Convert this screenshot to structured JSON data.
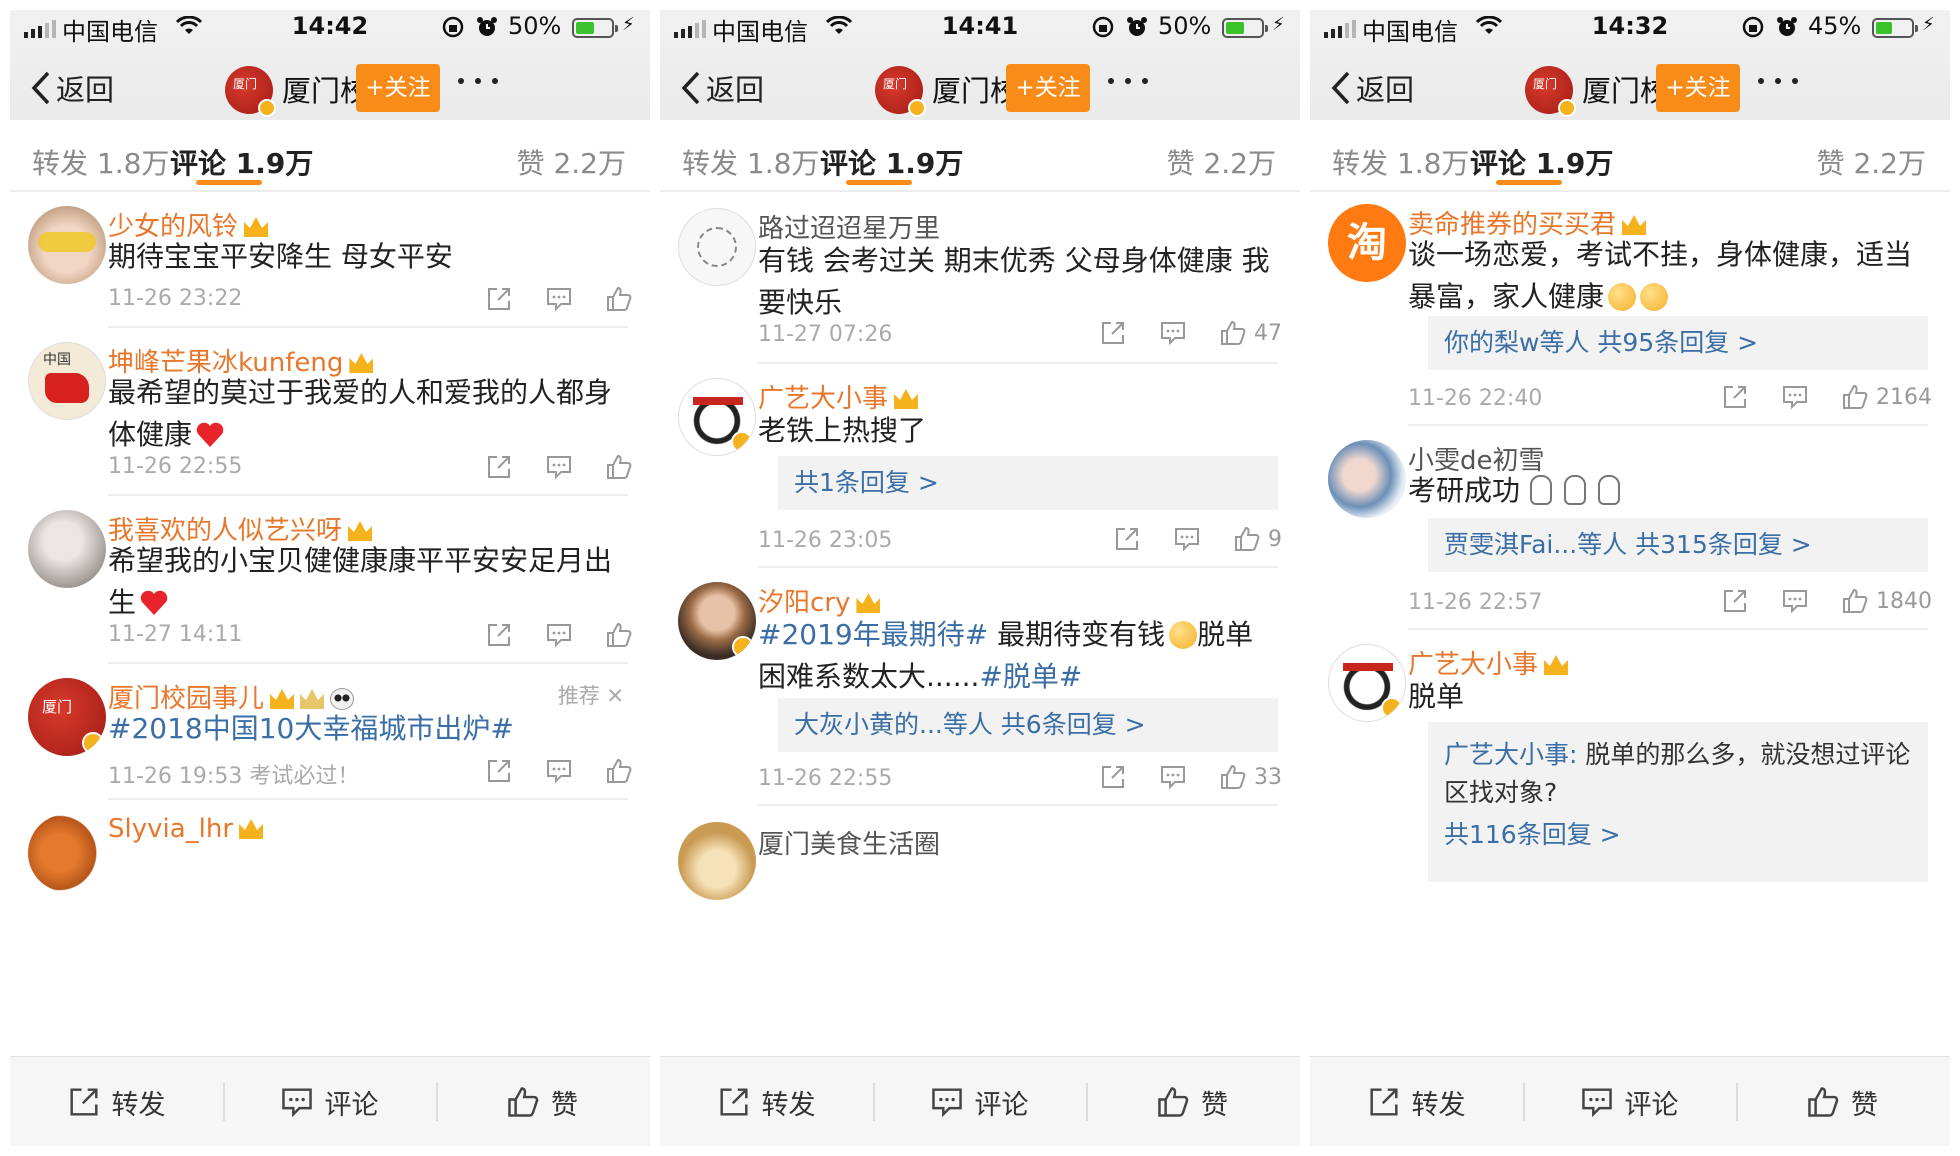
{
  "panels": [
    {
      "status": {
        "carrier": "中国电信",
        "time": "14:42",
        "battery": "50%"
      },
      "nav": {
        "back": "返回",
        "title": "厦门校园...",
        "follow": "+关注",
        "logo_text": "厦门"
      },
      "tabs": {
        "repost": "转发 1.8万",
        "comments": "评论 1.9万",
        "likes": "赞 2.2万"
      },
      "comments": [
        {
          "name": "少女的风铃",
          "text": "期待宝宝平安降生 母女平安",
          "time": "11-26 23:22",
          "likes": ""
        },
        {
          "name": "坤峰芒果冰kunfeng",
          "text": "最希望的莫过于我爱的人和爱我的人都身体健康",
          "time": "11-26 22:55",
          "likes": ""
        },
        {
          "name": "我喜欢的人似艺兴呀",
          "text": "希望我的小宝贝健健康康平平安安足月出生",
          "time": "11-27 14:11",
          "likes": ""
        },
        {
          "name": "厦门校园事儿",
          "text": "#2018中国10大幸福城市出炉#",
          "time": "11-26 19:53 考试必过！ ...",
          "likes": "",
          "tag": "推荐 ✕"
        },
        {
          "name": "Slyvia_lhr",
          "text": "",
          "time": "",
          "likes": ""
        }
      ],
      "bottom": {
        "repost": "转发",
        "comment": "评论",
        "like": "赞"
      }
    },
    {
      "status": {
        "carrier": "中国电信",
        "time": "14:41",
        "battery": "50%"
      },
      "nav": {
        "back": "返回",
        "title": "厦门校园...",
        "follow": "+关注",
        "logo_text": "厦门"
      },
      "tabs": {
        "repost": "转发 1.8万",
        "comments": "评论 1.9万",
        "likes": "赞 2.2万"
      },
      "comments": [
        {
          "name": "路过迢迢星万里",
          "text": "有钱 会考过关 期末优秀 父母身体健康 我要快乐",
          "time": "11-27 07:26",
          "likes": "47"
        },
        {
          "name": "广艺大小事",
          "text": "老铁上热搜了",
          "replies": "共1条回复 >",
          "time": "11-26 23:05",
          "likes": "9"
        },
        {
          "name": "汐阳cry",
          "text_topic1": "#2019年最期待#",
          "text_mid": " 最期待变有钱",
          "text_end": "脱单困难系数太大......",
          "text_topic2": "#脱单#",
          "replies": "大灰小黄的...等人  共6条回复 >",
          "time": "11-26 22:55",
          "likes": "33"
        },
        {
          "name": "厦门美食生活圈",
          "text": "",
          "time": "",
          "likes": ""
        }
      ],
      "bottom": {
        "repost": "转发",
        "comment": "评论",
        "like": "赞"
      }
    },
    {
      "status": {
        "carrier": "中国电信",
        "time": "14:32",
        "battery": "45%"
      },
      "nav": {
        "back": "返回",
        "title": "厦门校园...",
        "follow": "+关注",
        "logo_text": "厦门"
      },
      "tabs": {
        "repost": "转发 1.8万",
        "comments": "评论 1.9万",
        "likes": "赞 2.2万"
      },
      "comments": [
        {
          "name": "卖命推券的买买君",
          "text": "谈一场恋爱，考试不挂，身体健康，适当暴富，家人健康",
          "replies": "你的梨w等人  共95条回复 >",
          "time": "11-26 22:40",
          "likes": "2164",
          "avatar_char": "淘"
        },
        {
          "name": "小雯de初雪",
          "text": "考研成功",
          "replies": "贾雯淇Fai...等人  共315条回复 >",
          "time": "11-26 22:57",
          "likes": "1840"
        },
        {
          "name": "广艺大小事",
          "text": "脱单",
          "reply_author": "广艺大小事:",
          "reply_body": " 脱单的那么多，就没想过评论区找对象?",
          "replies": "共116条回复 >"
        }
      ],
      "bottom": {
        "repost": "转发",
        "comment": "评论",
        "like": "赞"
      }
    }
  ],
  "colors": {
    "accent": "#f98c19",
    "name_orange": "#e8772c",
    "link_blue": "#3a6ea5",
    "battery_green": "#39c22a"
  }
}
